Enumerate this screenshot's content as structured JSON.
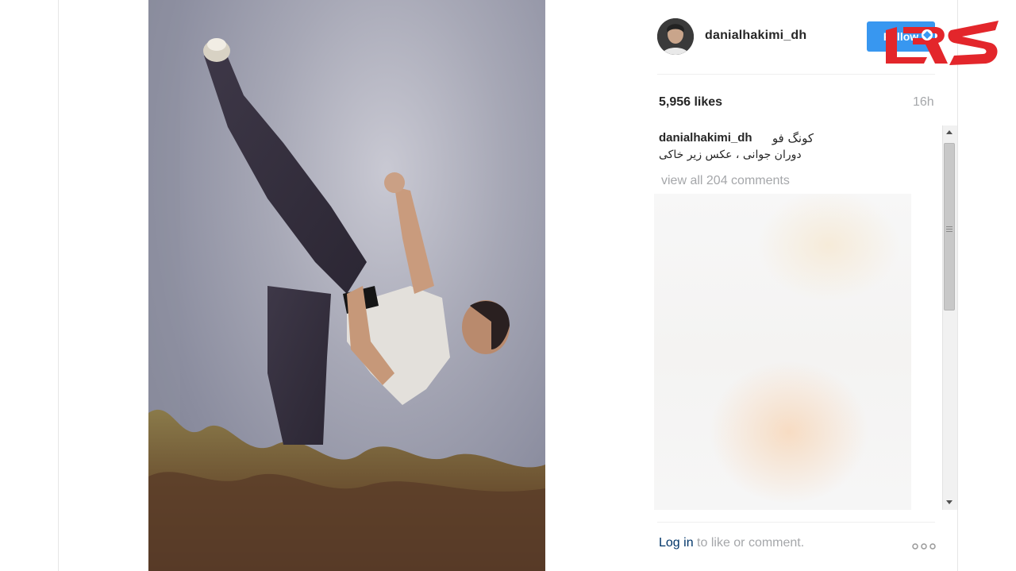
{
  "post": {
    "username": "danialhakimi_dh",
    "follow_label": "Follow",
    "likes": "5,956 likes",
    "time": "16h",
    "caption_user": "danialhakimi_dh",
    "caption_line1": "کونگ فو",
    "caption_line2": "دوران جوانی ، عکس زیر خاکی",
    "view_all_comments": "view all 204 comments",
    "footer": {
      "login": "Log in",
      "rest": " to like or comment."
    }
  },
  "icons": {
    "more": "more-options-icon",
    "scroll_up": "chevron-up-icon",
    "scroll_down": "chevron-down-icon"
  },
  "colors": {
    "follow_button": "#3897f0",
    "logo_red": "#e3262b",
    "link": "#003569",
    "muted": "#a5a7aa"
  }
}
